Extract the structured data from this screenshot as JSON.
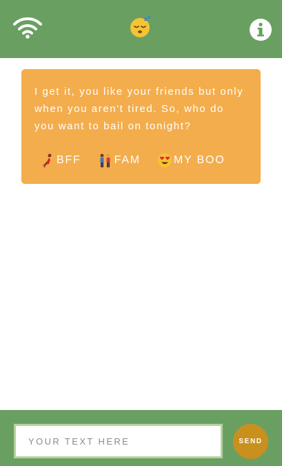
{
  "header": {
    "wifi_icon": "wifi-icon",
    "status_icon": "sleeping-face-icon",
    "info_icon": "info-icon"
  },
  "message": {
    "text": "I get it, you like your friends but only when you aren't tired. So, who do you want to bail on tonight?",
    "options": [
      {
        "icon": "dancer-icon",
        "label": "BFF"
      },
      {
        "icon": "family-icon",
        "label": "FAM"
      },
      {
        "icon": "heart-eyes-icon",
        "label": "MY BOO"
      }
    ]
  },
  "composer": {
    "placeholder": "YOUR TEXT HERE",
    "value": "",
    "send_label": "SEND"
  },
  "colors": {
    "header_bg": "#6a9f62",
    "card_bg": "#f4ad4c",
    "send_bg": "#c9901e",
    "input_border": "#b5d19c"
  }
}
